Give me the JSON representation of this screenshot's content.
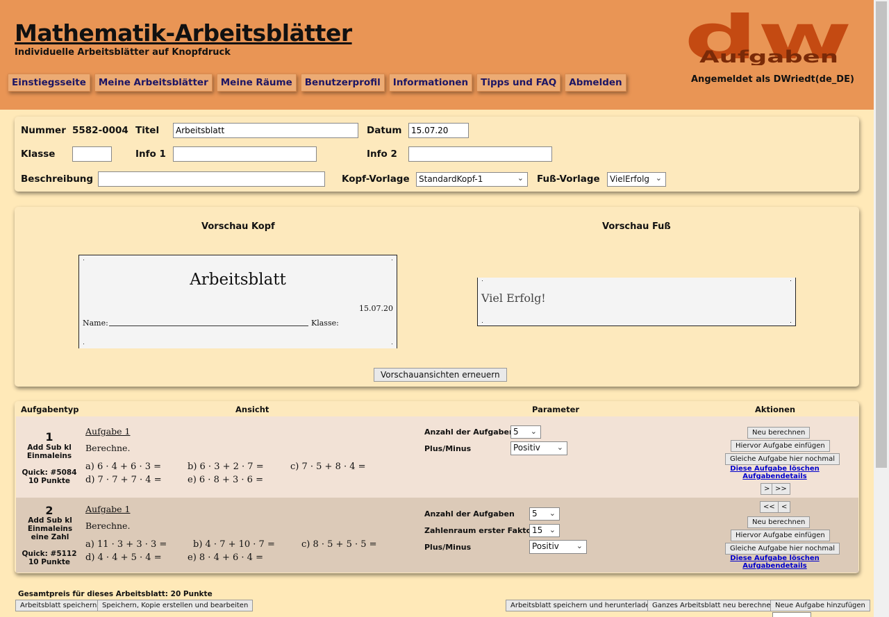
{
  "header": {
    "title": "Mathematik-Arbeitsblätter",
    "subtitle": "Individuelle Arbeitsblätter auf Knopfdruck",
    "logo_letters": "dw",
    "logo_word": "Aufgaben",
    "login_status": "Angemeldet als DWriedt(de_DE)",
    "nav": [
      "Einstiegsseite",
      "Meine Arbeitsblätter",
      "Meine Räume",
      "Benutzerprofil",
      "Informationen",
      "Tipps und FAQ",
      "Abmelden"
    ]
  },
  "meta": {
    "nummer_label": "Nummer",
    "nummer_value": "5582-0004",
    "titel_label": "Titel",
    "titel_value": "Arbeitsblatt",
    "datum_label": "Datum",
    "datum_value": "15.07.20",
    "klasse_label": "Klasse",
    "klasse_value": "",
    "info1_label": "Info 1",
    "info1_value": "",
    "info2_label": "Info 2",
    "info2_value": "",
    "beschreibung_label": "Beschreibung",
    "beschreibung_value": "",
    "kopf_label": "Kopf-Vorlage",
    "kopf_value": "StandardKopf-1",
    "fuss_label": "Fuß-Vorlage",
    "fuss_value": "VielErfolg"
  },
  "preview": {
    "kopf_title": "Vorschau Kopf",
    "fuss_title": "Vorschau Fuß",
    "kopf_heading": "Arbeitsblatt",
    "kopf_date": "15.07.20",
    "kopf_name": "Name:",
    "kopf_klasse": "Klasse:",
    "fuss_text": "Viel Erfolg!",
    "refresh_button": "Vorschauansichten erneuern"
  },
  "tasks_table": {
    "headers": [
      "Aufgabentyp",
      "Ansicht",
      "Parameter",
      "Aktionen"
    ],
    "tasks": [
      {
        "number": "1",
        "type": "Add Sub kl Einmaleins",
        "quick": "Quick: #5084",
        "points": "10 Punkte",
        "heading": "Aufgabe 1",
        "instruction": "Berechne.",
        "exercises": [
          "a) 6 · 4 + 6 · 3 =",
          "b) 6 · 3 + 2 · 7 =",
          "c) 7 · 5 + 8 · 4 =",
          "d) 7 · 7 + 7 · 4 =",
          "e) 6 · 8 + 3 · 6 ="
        ],
        "params": [
          {
            "label": "Anzahl der Aufgaben",
            "value": "5"
          },
          {
            "label": "Plus/Minus",
            "value": "Positiv"
          }
        ],
        "actions": {
          "recalc": "Neu berechnen",
          "insert_before": "Hiervor Aufgabe einfügen",
          "duplicate": "Gleiche Aufgabe hier nochmal",
          "delete": "Diese Aufgabe löschen",
          "details": "Aufgabendetails",
          "move_down": ">",
          "move_last": ">>"
        }
      },
      {
        "number": "2",
        "type": "Add Sub kl Einmaleins eine Zahl",
        "quick": "Quick: #5112",
        "points": "10 Punkte",
        "heading": "Aufgabe 1",
        "instruction": "Berechne.",
        "exercises": [
          "a) 11 · 3 + 3 · 3 =",
          "b) 4 · 7 + 10 · 7 =",
          "c) 8 · 5 + 5 · 5 =",
          "d) 4 · 4 + 5 · 4 =",
          "e) 8 · 4 + 6 · 4 ="
        ],
        "params": [
          {
            "label": "Anzahl der Aufgaben",
            "value": "5"
          },
          {
            "label": "Zahlenraum erster Faktor",
            "value": "15"
          },
          {
            "label": "Plus/Minus",
            "value": "Positiv"
          }
        ],
        "actions": {
          "move_first": "<<",
          "move_up": "<",
          "recalc": "Neu berechnen",
          "insert_before": "Hiervor Aufgabe einfügen",
          "duplicate": "Gleiche Aufgabe hier nochmal",
          "delete": "Diese Aufgabe löschen",
          "details": "Aufgabendetails"
        }
      }
    ]
  },
  "footer": {
    "total_price": "Gesamtpreis für dieses Arbeitsblatt: 20 Punkte",
    "buttons": [
      "Arbeitsblatt speichern",
      "Speichern, Kopie erstellen und bearbeiten",
      "Arbeitsblatt speichern und herunterladen",
      "Ganzes Arbeitsblatt neu berechnen",
      "Neue Aufgabe hinzufügen"
    ]
  },
  "colors": {
    "header_bg": "#e99555",
    "nav_text": "#1d1664",
    "panel_bg": "#fde9bd",
    "task1_bg": "#f2e2d6",
    "task2_bg": "#dccab8",
    "logo": "#c44a12"
  }
}
